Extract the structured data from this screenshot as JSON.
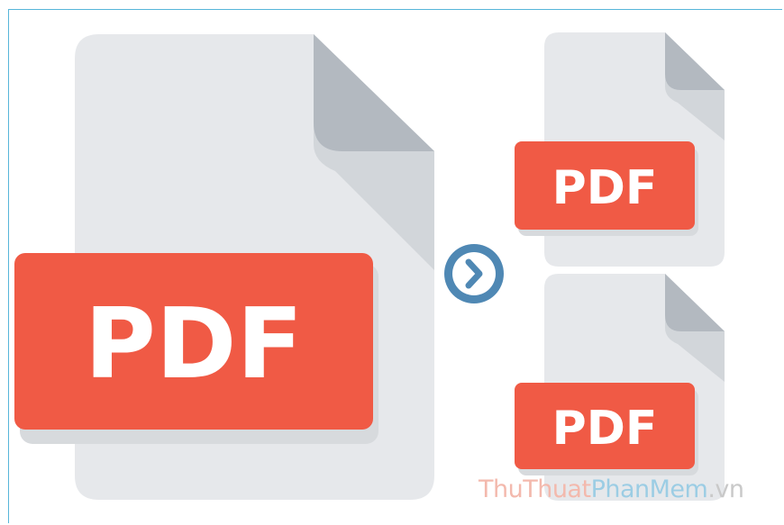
{
  "illustration": {
    "main_badge": "PDF",
    "output_badges": [
      "PDF",
      "PDF"
    ],
    "arrow_icon": "chevron-right-circle-icon"
  },
  "watermark": {
    "part1": "ThuThuat",
    "part2": "PhanMem",
    "part3": ".vn"
  },
  "colors": {
    "document": "#e6e8eb",
    "fold": "#b3b9c0",
    "fold_shadow": "#d2d6da",
    "badge": "#f05a45",
    "badge_shadow": "#d7dadd",
    "arrow_ring": "#4f88b4"
  }
}
